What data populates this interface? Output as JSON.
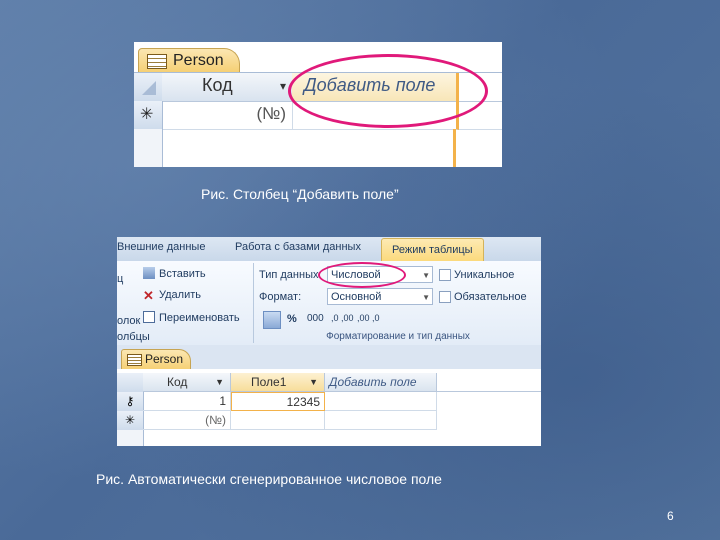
{
  "slide": {
    "caption1": "Рис.  Столбец “Добавить поле”",
    "caption2": "Рис. Автоматически сгенерированное числовое поле",
    "page_number": "6"
  },
  "screenshot1": {
    "tab_label": "Person",
    "column_kod": "Код",
    "column_add_field": "Добавить поле",
    "new_row_marker": "✳",
    "new_row_value": "(№)",
    "sort_arrow": "▾"
  },
  "screenshot2": {
    "ribbon_tabs": [
      "Внешние данные",
      "Работа с базами данных",
      "Режим таблицы"
    ],
    "buttons": {
      "insert": "Вставить",
      "delete": "Удалить",
      "rename": "Переименовать",
      "left_partial_1": "ц",
      "left_partial_2": "олок",
      "left_partial_3": "олбцы"
    },
    "data_type_label": "Тип данных:",
    "data_type_value": "Числовой",
    "format_label": "Формат:",
    "format_value": "Основной",
    "unique_label": "Уникальное",
    "required_label": "Обязательное",
    "format_buttons": [
      "%",
      "000",
      ",0 ,00",
      ",00 ,0"
    ],
    "group_label": "Форматирование и тип данных",
    "table_tab": "Person",
    "columns": [
      "Код",
      "Поле1",
      "Добавить поле"
    ],
    "rows": [
      {
        "marker": "⚷",
        "kod": "1",
        "pole1": "12345"
      },
      {
        "marker": "✳",
        "kod": "(№)",
        "pole1": ""
      }
    ]
  },
  "colors": {
    "highlight": "#e0197a",
    "tab_active": "#f5cf72"
  }
}
